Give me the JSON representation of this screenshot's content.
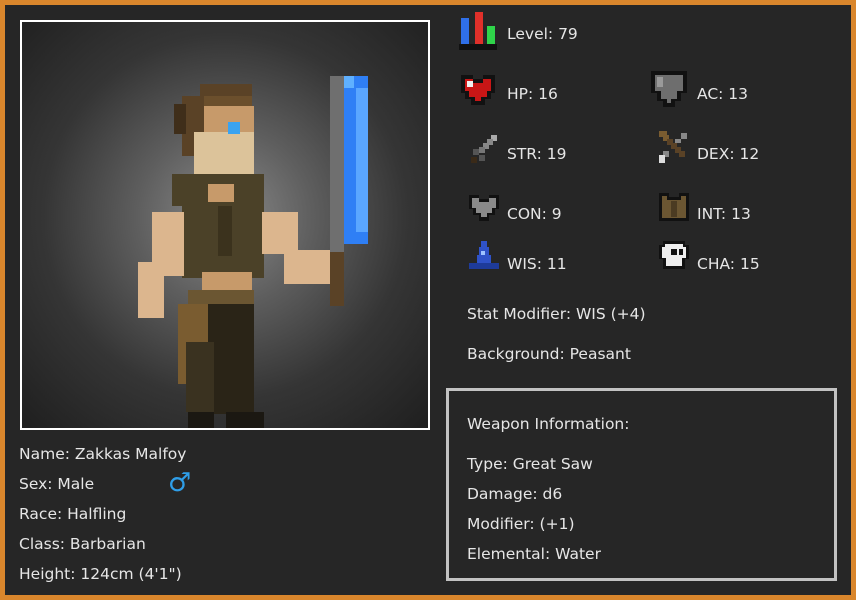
{
  "character": {
    "name_line": "Name: Zakkas Malfoy",
    "sex_line": "Sex: Male",
    "sex_symbol": "♂",
    "race_line": "Race: Halfling",
    "class_line": "Class: Barbarian",
    "height_line": "Height: 124cm (4'1\")"
  },
  "stats": {
    "level": "Level: 79",
    "hp": "HP: 16",
    "ac": "AC: 13",
    "str": "STR: 19",
    "dex": "DEX: 12",
    "con": "CON: 9",
    "int": "INT: 13",
    "wis": "WIS: 11",
    "cha": "CHA: 15",
    "stat_modifier": "Stat Modifier: WIS (+4)",
    "background": "Background: Peasant"
  },
  "weapon": {
    "heading": "Weapon Information:",
    "type": "Type: Great Saw",
    "damage": "Damage: d6",
    "modifier": "Modifier: (+1)",
    "elemental": "Elemental: Water"
  },
  "icons": {
    "level": "level-bars-icon",
    "hp": "heart-icon",
    "ac": "shield-icon",
    "str": "sword-icon",
    "dex": "crossbow-icon",
    "con": "grey-heart-icon",
    "int": "armor-icon",
    "wis": "wizard-hat-icon",
    "cha": "skull-icon"
  },
  "colors": {
    "border": "#d9862c",
    "panel": "#262626",
    "text": "#e6e6e6",
    "male_symbol": "#2f9ee8",
    "blade": "#2f7ff5"
  }
}
